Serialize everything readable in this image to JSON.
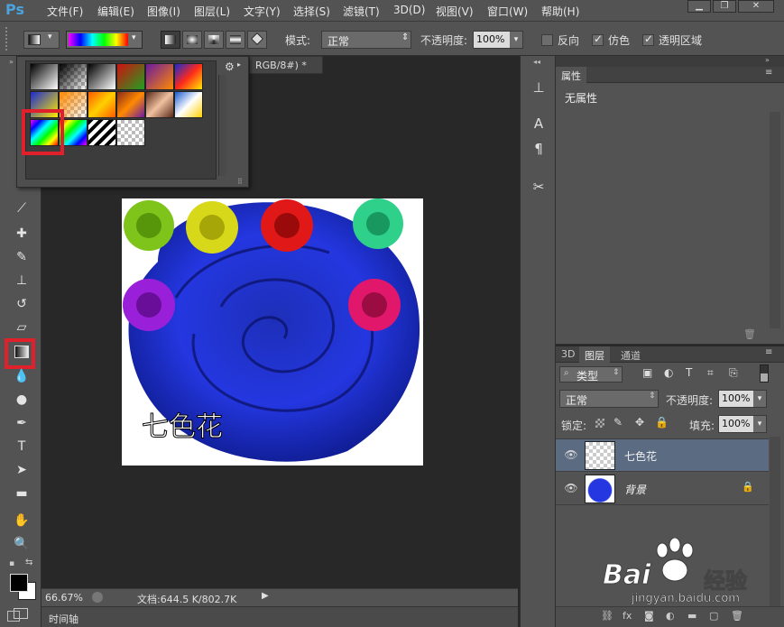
{
  "app": {
    "logo": "Ps"
  },
  "menu": [
    "文件(F)",
    "编辑(E)",
    "图像(I)",
    "图层(L)",
    "文字(Y)",
    "选择(S)",
    "滤镜(T)",
    "3D(D)",
    "视图(V)",
    "窗口(W)",
    "帮助(H)"
  ],
  "window_buttons": [
    "▁",
    "❐",
    "✕"
  ],
  "options": {
    "mode_label": "模式:",
    "mode_value": "正常",
    "opacity_label": "不透明度:",
    "opacity_value": "100%",
    "reverse_label": "反向",
    "reverse_checked": false,
    "dither_label": "仿色",
    "dither_checked": true,
    "transparency_label": "透明区域",
    "transparency_checked": true
  },
  "document": {
    "tab_title": "RGB/8#) *"
  },
  "status": {
    "zoom": "66.67%",
    "doc_info": "文档:644.5 K/802.7K",
    "timeline_label": "时间轴"
  },
  "canvas": {
    "caption": "七色花"
  },
  "properties": {
    "tab": "属性",
    "empty_text": "无属性"
  },
  "layers": {
    "tabs": [
      "3D",
      "图层",
      "通道"
    ],
    "filter_label": "类型",
    "blend_mode": "正常",
    "opacity_label": "不透明度:",
    "opacity_value": "100%",
    "lock_label": "锁定:",
    "fill_label": "填充:",
    "fill_value": "100%",
    "items": [
      {
        "name": "七色花",
        "selected": true
      },
      {
        "name": "背景",
        "selected": false,
        "locked": true
      }
    ]
  },
  "watermark": {
    "brand": "Bai",
    "brand2": "经验",
    "url": "jingyan.baidu.com"
  },
  "icons": [
    "gradient-tool-icon",
    "eye-icon",
    "lock-icon",
    "gear-icon",
    "text-icon",
    "zoom-icon",
    "hand-icon",
    "brush-icon",
    "eyedropper-icon",
    "pen-icon"
  ],
  "colors": {
    "panel": "#535353",
    "canvas_bg": "#282828",
    "highlight": "#e0202a",
    "selected_layer": "#5b6b82",
    "logo": "#4aa3df"
  }
}
